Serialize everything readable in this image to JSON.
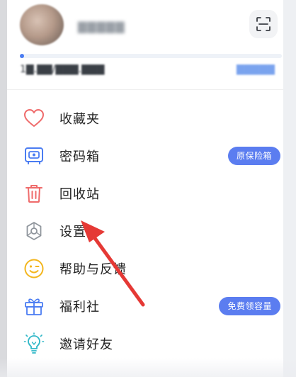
{
  "header": {
    "username": "▇▇▇▇▇",
    "storage_text": "1▇.▇▇/▇▇▇.▇▇▇",
    "storage_link": "▇▇▇▇▇",
    "storage_progress_fraction": 0.01
  },
  "menu": {
    "items": [
      {
        "label": "收藏夹",
        "icon": "heart-icon"
      },
      {
        "label": "密码箱",
        "icon": "safe-icon",
        "badge": "原保险箱"
      },
      {
        "label": "回收站",
        "icon": "trash-icon"
      },
      {
        "label": "设置",
        "icon": "gear-icon"
      },
      {
        "label": "帮助与反馈",
        "icon": "smiley-icon"
      },
      {
        "label": "福利社",
        "icon": "gift-icon",
        "badge": "免费领容量"
      },
      {
        "label": "邀请好友",
        "icon": "lightbulb-icon"
      }
    ]
  },
  "colors": {
    "accent": "#5b7df0",
    "heart": "#ef6b6b",
    "safe": "#4a7cf2",
    "trash": "#ef6b6b",
    "gear": "#8f959c",
    "smiley": "#f3b61f",
    "gift": "#4a7cf2",
    "lightbulb": "#2fb7c7",
    "arrow": "#e53935"
  }
}
